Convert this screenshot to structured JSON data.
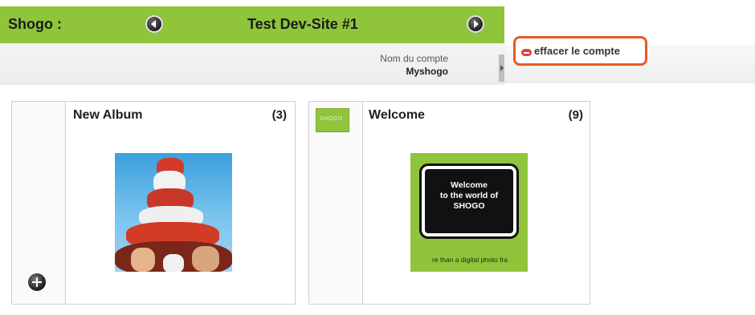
{
  "header": {
    "brand": "Shogo :",
    "site_title": "Test Dev-Site #1"
  },
  "account": {
    "label": "Nom du compte",
    "name": "Myshogo",
    "delete_label": "effacer le compte"
  },
  "albums": [
    {
      "title": "New Album",
      "count": "(3)",
      "thumbnail": "photo-human-tower"
    },
    {
      "title": "Welcome",
      "count": "(9)",
      "logo_text": "SHOGO",
      "card_lines": [
        "Welcome",
        "to the world of",
        "SHOGO"
      ],
      "card_tagline": "re than a digital photo fra"
    }
  ],
  "colors": {
    "brand_green": "#8fc43b",
    "highlight_orange": "#e85a24",
    "delete_red": "#e04040"
  },
  "icons": {
    "prev": "arrow-left-circle-icon",
    "next": "arrow-right-circle-icon",
    "delete": "minus-pill-icon",
    "add": "plus-circle-icon"
  }
}
